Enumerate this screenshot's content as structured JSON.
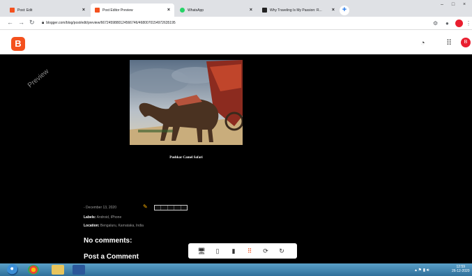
{
  "tabs": [
    {
      "label": "Post: Edit",
      "active": false,
      "color": "#f4511e"
    },
    {
      "label": "Post Editor Preview",
      "active": true,
      "color": "#f4511e"
    },
    {
      "label": "WhatsApp",
      "active": false,
      "color": "#25d366"
    },
    {
      "label": "Why Traveling Is My Passion: R...",
      "active": false,
      "color": "#222222"
    }
  ],
  "address": {
    "url": "blogger.com/blog/post/edit/preview/6672459880124566746/4680070154972635195"
  },
  "header": {
    "logo_letter": "B",
    "avatar_letter": "B"
  },
  "content": {
    "watermark": "Preview",
    "caption": "Pushkar Camel Safari",
    "date": "- December 13, 2020",
    "labels_key": "Labels:",
    "labels_value": "Android, iPhone",
    "location_key": "Location:",
    "location_value": "Bengaluru, Karnataka, India",
    "comments_heading": "No comments:",
    "post_comment_heading": "Post a Comment"
  },
  "clock": {
    "time": "12:59",
    "date": "26-12-2020"
  },
  "colors": {
    "accent": "#f4511e",
    "background": "#000000"
  }
}
